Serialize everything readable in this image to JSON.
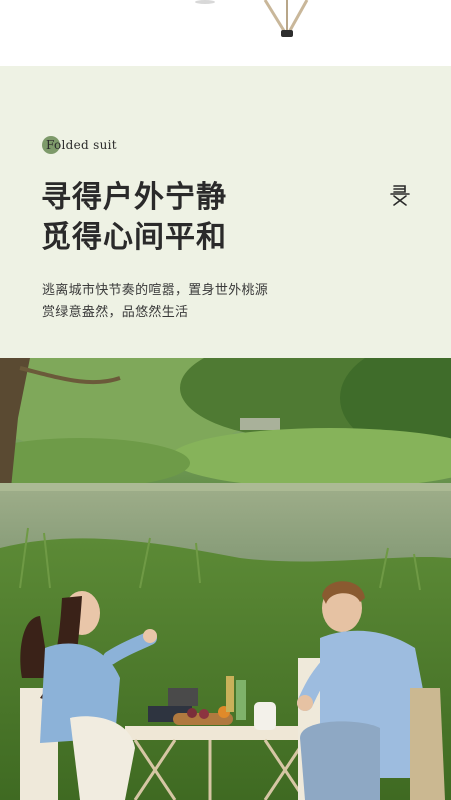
{
  "badge": {
    "text": "Folded suit"
  },
  "headline": {
    "line1": "寻得户外宁静",
    "line2": "觅得心间平和"
  },
  "body": {
    "line1": "逃离城市快节奏的喧嚣，置身世外桃源",
    "line2": "赏绿意盎然，品悠然生活"
  },
  "photo": {
    "description_icon": "camping-scene-image"
  },
  "icons": {
    "brand_mark": "brand-mark-icon"
  },
  "colors": {
    "panel_bg": "#eef2e4",
    "badge_dot": "#7d9a6a",
    "text": "#2a2a2a"
  }
}
